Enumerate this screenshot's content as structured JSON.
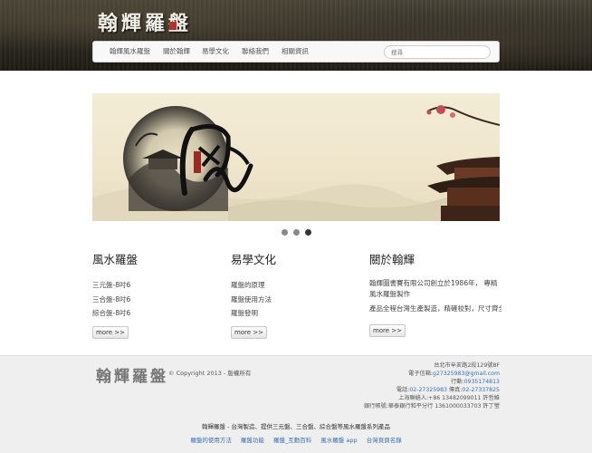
{
  "header": {
    "logo_text": "翰輝羅盤",
    "nav": [
      "翰輝風水羅盤",
      "關於翰輝",
      "易學文化",
      "聯絡我們",
      "相關資訊"
    ],
    "search_placeholder": "搜尋"
  },
  "carousel": {
    "slide_calligraphy": "風水",
    "slide_seal": "翰輝羅盤",
    "slide_count": 3,
    "active_index": 2
  },
  "columns": [
    {
      "title": "風水羅盤",
      "items": [
        "三元盤-8吋6",
        "三合盤-8吋6",
        "綜合盤-8吋6"
      ],
      "more": "more >>"
    },
    {
      "title": "易學文化",
      "items": [
        "羅盤的原理",
        "羅盤使用方法",
        "羅盤發明"
      ],
      "more": "more >>"
    },
    {
      "title": "關於翰輝",
      "paragraphs": [
        "翰輝圖書賽有限公司創立於1986年， 專精風水羅盤製作",
        "產品全程台灣生產製造，精確校對，尺寸齊全"
      ],
      "more": "more >>"
    }
  ],
  "footer": {
    "logo_text": "翰輝羅盤",
    "copyright": "© Copyright 2013 - 版權所有",
    "address": "台北市辛亥路2段129號8F",
    "email_label": "電子信箱:",
    "email": "g27325983@gmail.com",
    "mobile_label": "行動:",
    "mobile": "0935174813",
    "phone_label": "電話:",
    "phone": "02-27325983",
    "fax_label": " 傳真:",
    "fax": "02-27337825",
    "shanghai": "上海聯絡人:+86 13482099011 許哲維",
    "bank": "銀行帳號:華泰銀行和平分行 1361000033703 許丁瑩",
    "tagline": "翰輝羅盤 - 台灣製造、提供三元盤、三合盤、綜合盤等風水羅盤系列產品",
    "links": [
      "羅盤的使用方法",
      "羅盤功能",
      "羅盤_互動百科",
      "風水羅盤 app",
      "台灣頁頁名錄"
    ]
  }
}
